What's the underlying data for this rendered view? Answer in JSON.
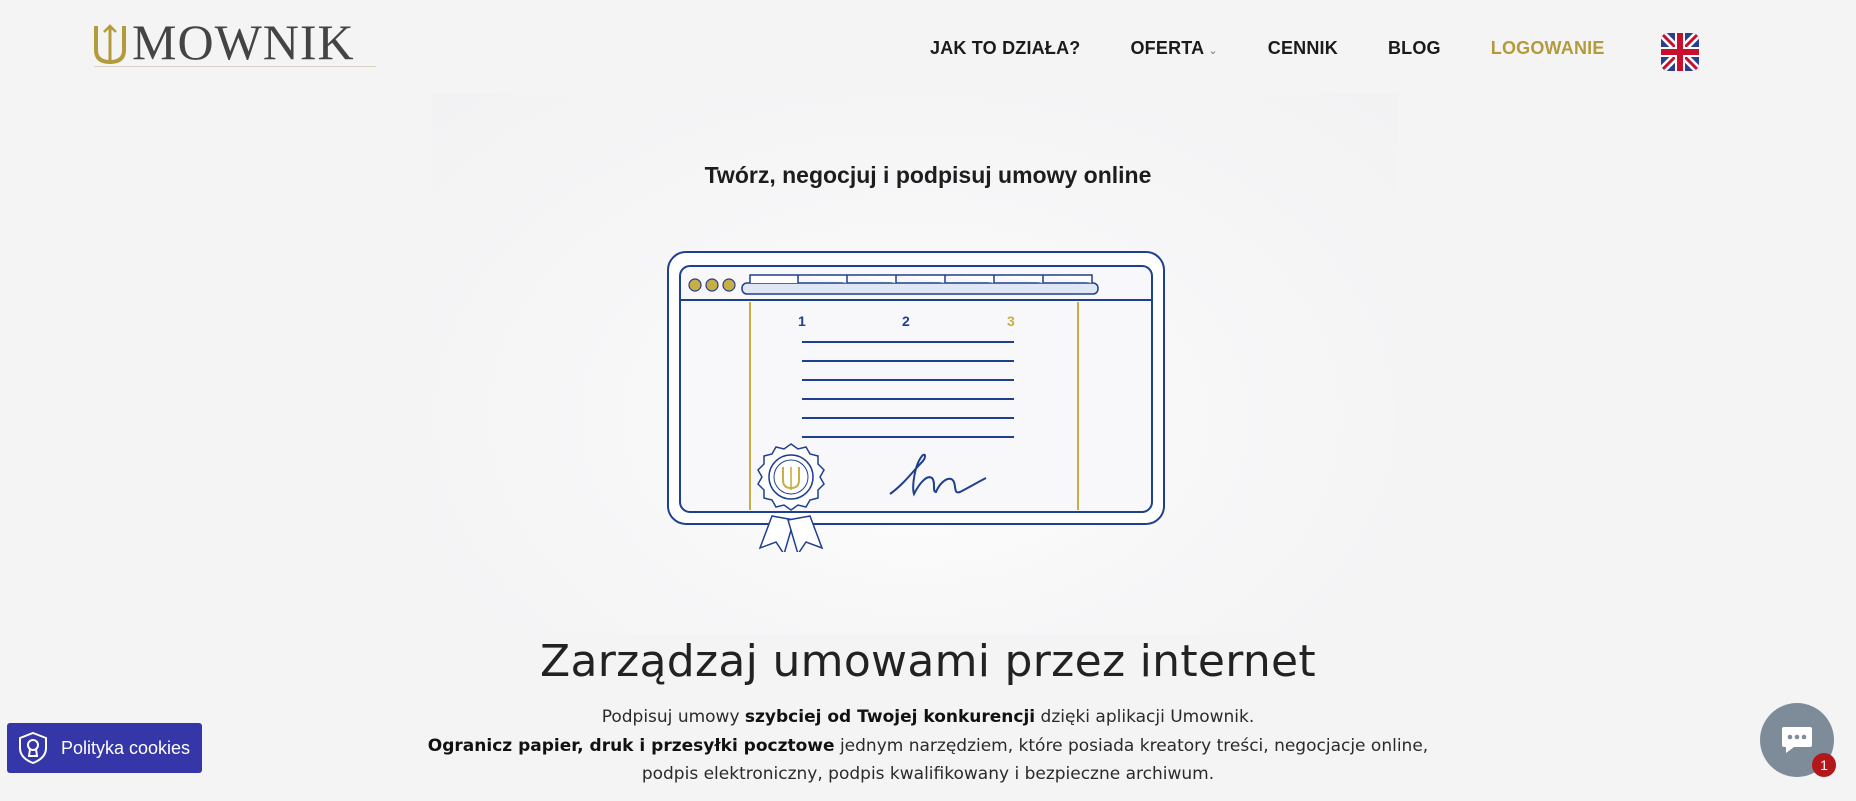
{
  "header": {
    "logo_text": "MOWNIK",
    "nav": [
      {
        "label": "JAK TO DZIAŁA?"
      },
      {
        "label": "OFERTA"
      },
      {
        "label": "CENNIK"
      },
      {
        "label": "BLOG"
      },
      {
        "label": "LOGOWANIE"
      }
    ],
    "language_flag": "uk-flag-icon"
  },
  "hero": {
    "tagline": "Twórz, negocjuj i podpisuj umowy online",
    "illustration": {
      "steps": [
        "1",
        "2",
        "3"
      ],
      "seal_icon": "seal-icon"
    },
    "headline": "Zarządzaj umowami przez internet",
    "sub1_a": "Podpisuj umowy ",
    "sub1_b": "szybciej od Twojej konkurencji",
    "sub1_c": " dzięki aplikacji Umownik.",
    "sub2_a": "Ogranicz papier, druk i przesyłki pocztowe",
    "sub2_b": " jednym narzędziem, które posiada kreatory treści, negocjacje online,",
    "sub3": "podpis elektroniczny, podpis kwalifikowany i bezpieczne archiwum."
  },
  "cookie": {
    "label": "Polityka cookies"
  },
  "chat": {
    "badge": "1"
  },
  "colors": {
    "gold": "#b39b3b",
    "navy": "#1f3f8f",
    "cookie_bg": "#3537a8"
  }
}
